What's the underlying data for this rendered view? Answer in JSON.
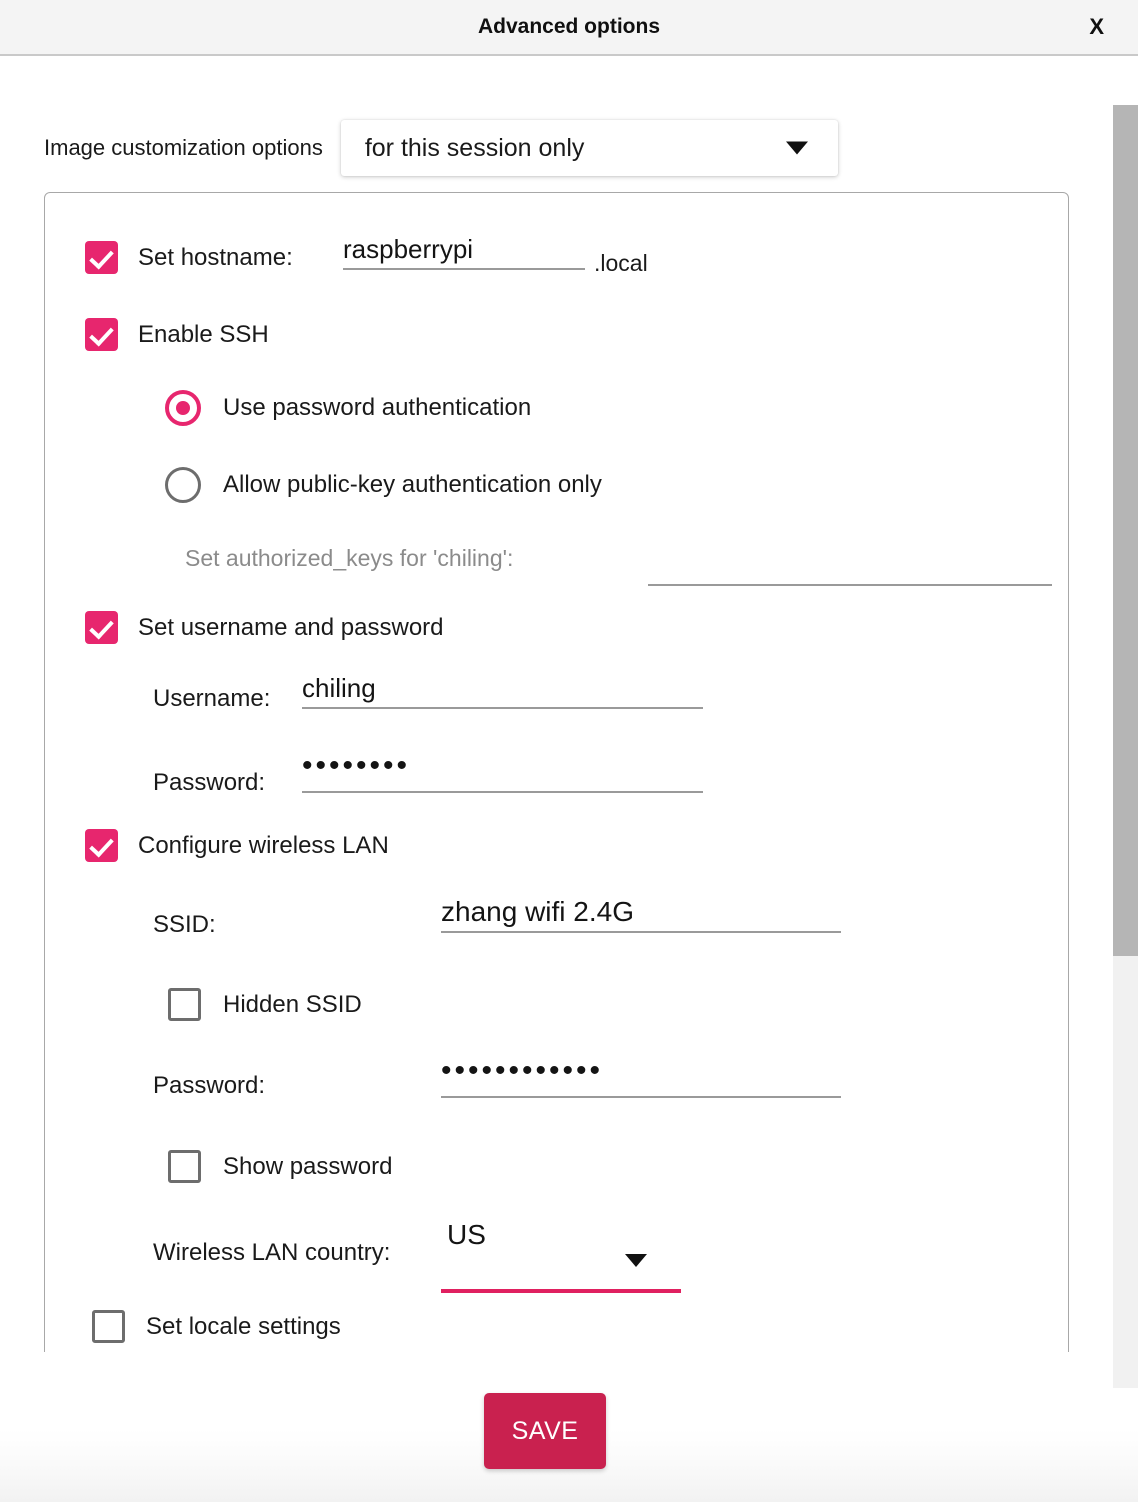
{
  "window": {
    "title": "Advanced options",
    "close_label": "X"
  },
  "customization": {
    "label": "Image customization options",
    "selected": "for this session only",
    "dropdown_icon": "chevron-down-icon"
  },
  "hostname": {
    "checkbox_label": "Set hostname:",
    "checked": true,
    "value": "raspberrypi",
    "suffix": ".local"
  },
  "ssh": {
    "checkbox_label": "Enable SSH",
    "checked": true,
    "radio_password_label": "Use password authentication",
    "radio_password_selected": true,
    "radio_pubkey_label": "Allow public-key authentication only",
    "radio_pubkey_selected": false,
    "authorized_keys_label": "Set authorized_keys for 'chiling':",
    "authorized_keys_value": ""
  },
  "user": {
    "checkbox_label": "Set username and password",
    "checked": true,
    "username_label": "Username:",
    "username_value": "chiling",
    "password_label": "Password:",
    "password_masked": "••••••••"
  },
  "wireless": {
    "checkbox_label": "Configure wireless LAN",
    "checked": true,
    "ssid_label": "SSID:",
    "ssid_value": "zhang wifi 2.4G",
    "hidden_ssid_label": "Hidden SSID",
    "hidden_ssid_checked": false,
    "password_label": "Password:",
    "password_masked": "••••••••••••",
    "show_password_label": "Show password",
    "show_password_checked": false,
    "country_label": "Wireless LAN country:",
    "country_value": "US",
    "country_icon": "chevron-down-icon"
  },
  "locale": {
    "checkbox_label": "Set locale settings",
    "checked": false
  },
  "footer": {
    "save_label": "SAVE"
  },
  "colors": {
    "accent_pink": "#e7266e",
    "save_crimson": "#c9214f",
    "focus_halo": "#fbdde8",
    "titlebar_bg": "#f4f4f4",
    "scrollbar_thumb": "#b5b5b5"
  }
}
